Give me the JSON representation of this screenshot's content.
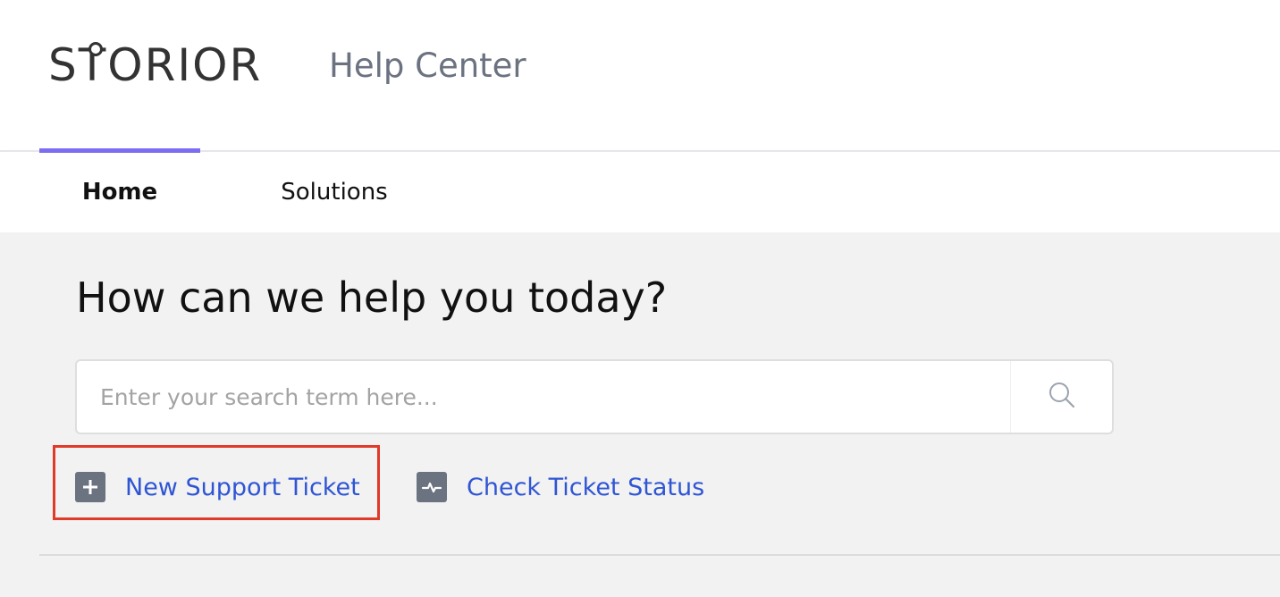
{
  "brand": {
    "logo_text_pre": "S",
    "logo_text_t": "T",
    "logo_text_post": "ORIOR",
    "title": "Help Center"
  },
  "nav": {
    "tabs": [
      {
        "label": "Home",
        "active": true
      },
      {
        "label": "Solutions",
        "active": false
      }
    ],
    "active_indicator_color": "#7c6cf0"
  },
  "main": {
    "headline": "How can we help you today?",
    "search": {
      "placeholder": "Enter your search term here...",
      "value": "",
      "icon": "search-icon"
    },
    "actions": [
      {
        "label": "New Support Ticket",
        "icon": "plus-square-icon",
        "highlighted": true
      },
      {
        "label": "Check Ticket Status",
        "icon": "activity-pulse-icon",
        "highlighted": false
      }
    ]
  },
  "colors": {
    "link": "#2f55d4",
    "highlight_border": "#e03a28",
    "icon_bg": "#6b7280",
    "page_bg": "#f2f2f2"
  }
}
